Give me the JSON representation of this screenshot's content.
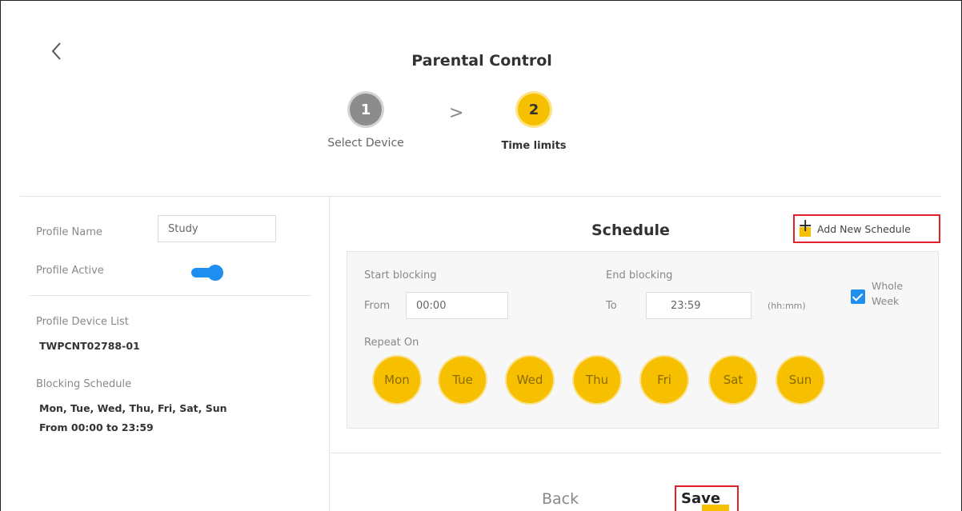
{
  "header": {
    "back_icon": "chevron-left-icon",
    "title": "Parental Control"
  },
  "steps": [
    {
      "number": "1",
      "label": "Select Device",
      "state": "completed"
    },
    {
      "number": "2",
      "label": "Time limits",
      "state": "active"
    }
  ],
  "step_separator": ">",
  "profile": {
    "name_label": "Profile Name",
    "name_value": "Study",
    "active_label": "Profile Active",
    "active": true,
    "device_list_label": "Profile Device List",
    "device": "TWPCNT02788-01",
    "blocking_label": "Blocking Schedule",
    "blocking_days": "Mon, Tue, Wed, Thu, Fri, Sat, Sun",
    "blocking_time": "From 00:00 to 23:59"
  },
  "schedule": {
    "title": "Schedule",
    "add_button": "Add New Schedule",
    "add_icon": "plus-icon",
    "start_label": "Start blocking",
    "from_label": "From",
    "from_value": "00:00",
    "end_label": "End blocking",
    "to_label": "To",
    "to_value": "23:59",
    "time_format": "(hh:mm)",
    "whole_week_line1": "Whole",
    "whole_week_line2": "Week",
    "whole_week_checked": true,
    "repeat_label": "Repeat On",
    "days": [
      "Mon",
      "Tue",
      "Wed",
      "Thu",
      "Fri",
      "Sat",
      "Sun"
    ]
  },
  "footer": {
    "back_label": "Back",
    "save_label": "Save"
  },
  "colors": {
    "accent_yellow": "#f6c000",
    "toggle_blue": "#1f8ef1",
    "highlight_red": "#e0202a"
  }
}
